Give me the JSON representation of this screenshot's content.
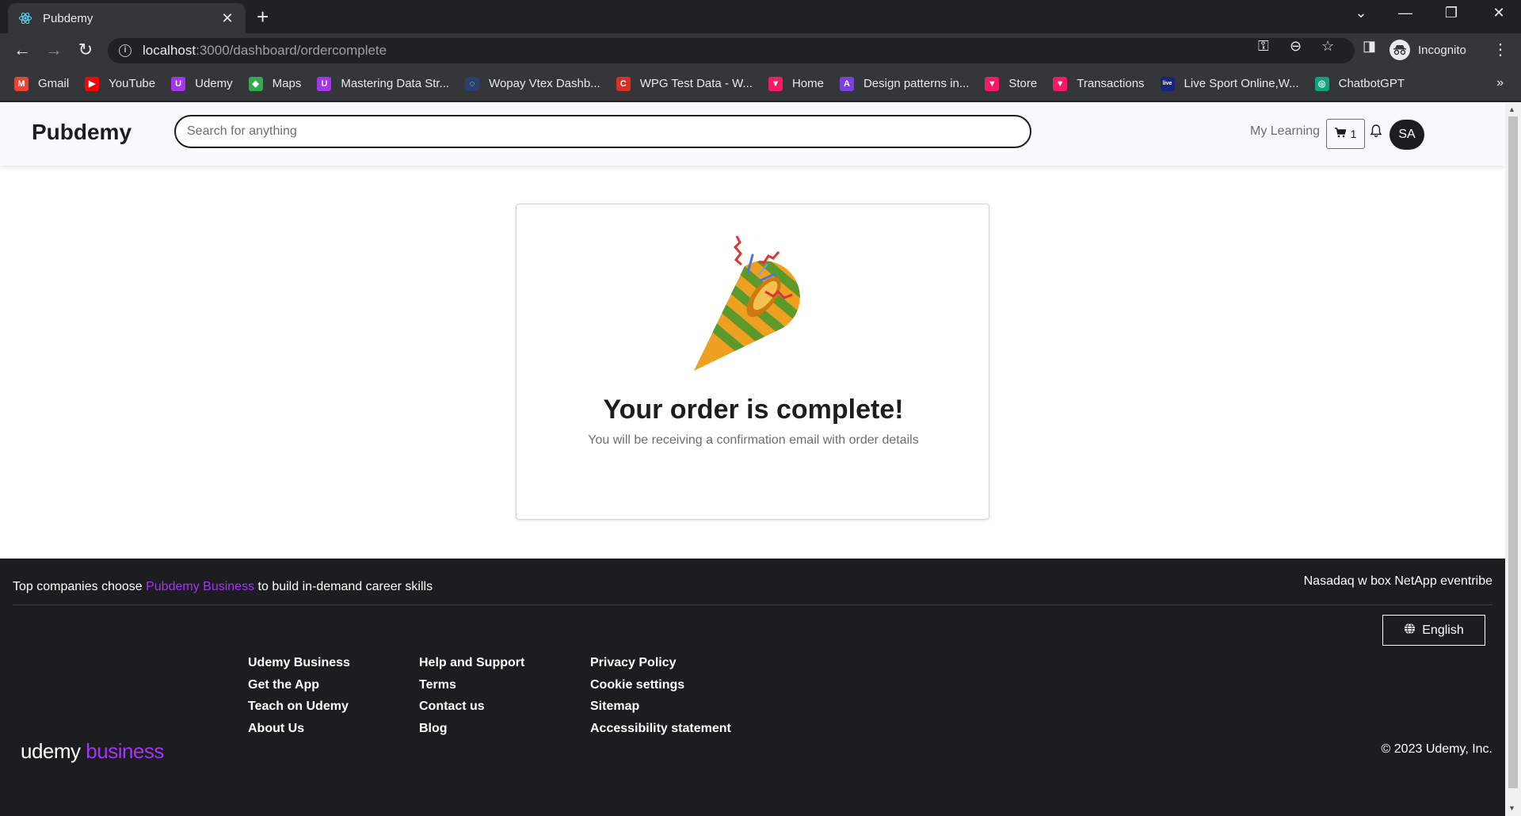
{
  "browser": {
    "tab_title": "Pubdemy",
    "url_host": "localhost",
    "url_path": ":3000/dashboard/ordercomplete",
    "profile_label": "Incognito",
    "bookmarks": [
      {
        "label": "Gmail",
        "icon": "gmail-icon",
        "color": "#ea4335",
        "glyph": "M"
      },
      {
        "label": "YouTube",
        "icon": "youtube-icon",
        "color": "#ff0000",
        "glyph": "▶"
      },
      {
        "label": "Udemy",
        "icon": "udemy-icon",
        "color": "#a435f0",
        "glyph": "U"
      },
      {
        "label": "Maps",
        "icon": "maps-icon",
        "color": "#34a853",
        "glyph": "◆"
      },
      {
        "label": "Mastering Data Str...",
        "icon": "udemy-icon",
        "color": "#a435f0",
        "glyph": "U"
      },
      {
        "label": "Wopay Vtex Dashb...",
        "icon": "globe-icon",
        "color": "#2a3f6a",
        "glyph": "◌"
      },
      {
        "label": "WPG Test Data - W...",
        "icon": "wpg-icon",
        "color": "#d93025",
        "glyph": "C"
      },
      {
        "label": "Home",
        "icon": "vtex-icon",
        "color": "#f71963",
        "glyph": "▼"
      },
      {
        "label": "Design patterns in...",
        "icon": "bookmark-purple-icon",
        "color": "#7b3fe4",
        "glyph": "A"
      },
      {
        "label": "Store",
        "icon": "vtex-icon",
        "color": "#f71963",
        "glyph": "▼"
      },
      {
        "label": "Transactions",
        "icon": "vtex-icon",
        "color": "#f71963",
        "glyph": "▼"
      },
      {
        "label": "Live Sport Online,W...",
        "icon": "live-sport-icon",
        "color": "#1a237e",
        "glyph": "live"
      },
      {
        "label": "ChatbotGPT",
        "icon": "chatgpt-icon",
        "color": "#10a37f",
        "glyph": "◎"
      }
    ]
  },
  "header": {
    "brand": "Pubdemy",
    "search_placeholder": "Search for anything",
    "my_learning": "My Learning",
    "cart_count": "1",
    "avatar_initials": "SA"
  },
  "order": {
    "title": "Your order is complete!",
    "subtitle": "You will be receiving a confirmation email with order details",
    "icon": "party-popper-icon"
  },
  "footer": {
    "tagline_pre": "Top companies choose ",
    "tagline_link": "Pubdemy Business",
    "tagline_post": " to build in-demand career skills",
    "partner_logos": "Nasadaq w box NetApp eventribe",
    "language": "English",
    "columns": [
      [
        "Udemy Business",
        "Get the App",
        "Teach on Udemy",
        "About Us"
      ],
      [
        "Help and Support",
        "Terms",
        "Contact us",
        "Blog"
      ],
      [
        "Privacy Policy",
        "Cookie settings",
        "Sitemap",
        "Accessibility statement"
      ]
    ],
    "logo_u": "udemy",
    "logo_b": " business",
    "copyright": "© 2023 Udemy, Inc."
  },
  "colors": {
    "accent": "#a435f0",
    "footer_bg": "#1c1d1f",
    "chrome_bg": "#35363a"
  }
}
